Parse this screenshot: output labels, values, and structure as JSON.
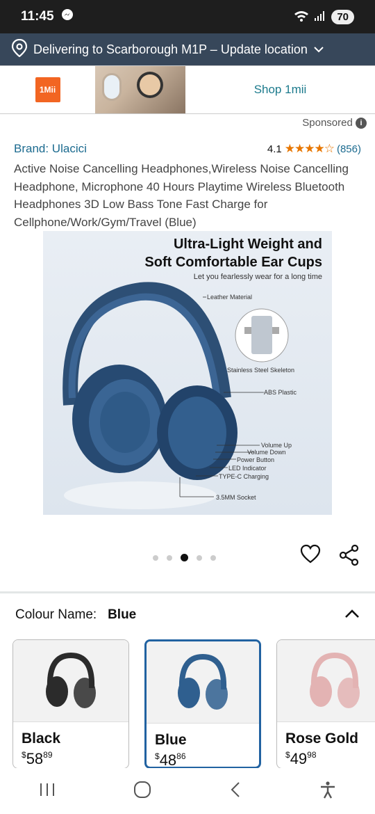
{
  "status_bar": {
    "time": "11:45",
    "battery": "70"
  },
  "location": {
    "text": "Delivering to Scarborough M1P – Update location"
  },
  "ad": {
    "logo_text": "1Mii",
    "shop_label": "Shop 1mii"
  },
  "sponsored_label": "Sponsored",
  "product": {
    "brand": "Brand: Ulacici",
    "rating_value": "4.1",
    "rating_stars": 4.1,
    "rating_count": "(856)",
    "title": "Active Noise Cancelling Headphones,Wireless Noise Cancelling Headphone, Microphone 40 Hours Playtime Wireless Bluetooth Headphones 3D Low Bass Tone Fast Charge for Cellphone/Work/Gym/Travel (Blue)"
  },
  "image_text": {
    "headline_1": "Ultra-Light Weight and",
    "headline_2": "Soft Comfortable Ear Cups",
    "subline": "Let you fearlessly wear for a long time",
    "labels": {
      "leather": "Leather Material",
      "steel": "Stainless Steel Skeleton",
      "abs": "ABS Plastic",
      "vol_up": "Volume Up",
      "vol_down": "Volume Down",
      "power": "Power Button",
      "led": "LED Indicator",
      "typec": "TYPE-C Charging",
      "socket": "3.5MM Socket"
    }
  },
  "carousel": {
    "total_dots": 5,
    "active_index": 2
  },
  "colour": {
    "label": "Colour Name:",
    "selected": "Blue",
    "options": [
      {
        "name": "Black",
        "currency": "$",
        "dollars": "58",
        "cents": "89",
        "color": "#2b2b2b"
      },
      {
        "name": "Blue",
        "currency": "$",
        "dollars": "48",
        "cents": "86",
        "color": "#2f5f8f"
      },
      {
        "name": "Rose Gold",
        "currency": "$",
        "dollars": "49",
        "cents": "98",
        "color": "#e3b3b3"
      }
    ]
  },
  "colors": {
    "accent": "#2162a1",
    "location_bg": "#37475a",
    "star": "#e77600",
    "link": "#1b6a8f"
  }
}
